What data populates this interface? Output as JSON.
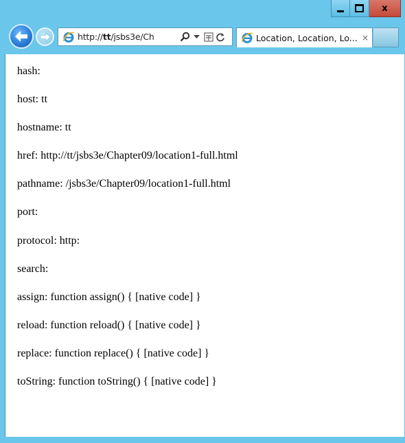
{
  "window": {
    "caption_buttons": {
      "minimize_icon": "minimize-icon",
      "maximize_icon": "maximize-icon",
      "close_label": "x"
    }
  },
  "navigation": {
    "back_icon": "back-arrow-icon",
    "forward_icon": "forward-arrow-icon",
    "address": {
      "prefix": "http://",
      "host": "tt",
      "rest": "/jsbs3e/Ch"
    },
    "tools": {
      "search_icon": "search-icon",
      "dropdown_icon": "chevron-down-icon",
      "compat_icon": "compatibility-view-icon",
      "refresh_icon": "refresh-icon"
    }
  },
  "tab": {
    "label": "Location, Location, Lo...",
    "close_label": "×"
  },
  "content": {
    "properties": [
      "hash:",
      "host: tt",
      "hostname: tt",
      "href: http://tt/jsbs3e/Chapter09/location1-full.html",
      "pathname: /jsbs3e/Chapter09/location1-full.html",
      "port:",
      "protocol: http:",
      "search:",
      "assign: function assign() { [native code] }",
      "reload: function reload() { [native code] }",
      "replace: function replace() { [native code] }",
      "toString: function toString() { [native code] }"
    ]
  },
  "colors": {
    "frame": "#6ac6ea",
    "close_button": "#c5493a"
  }
}
